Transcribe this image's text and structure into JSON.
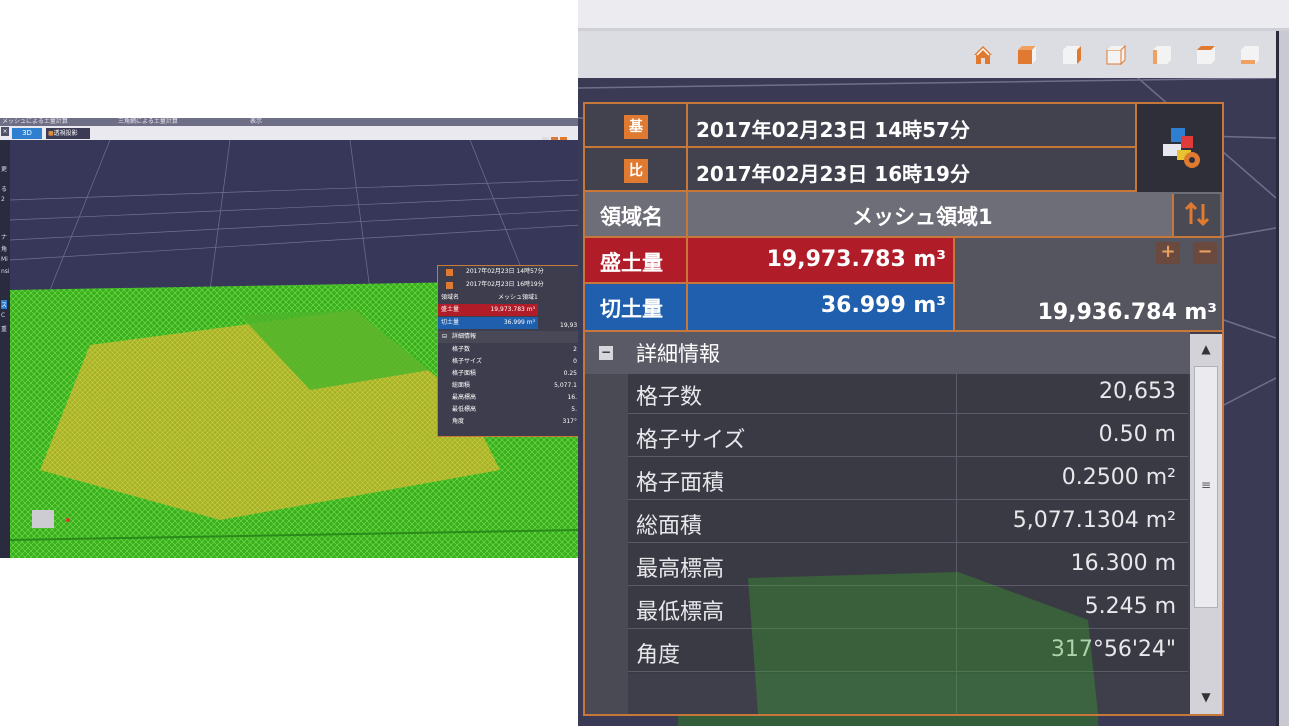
{
  "small_screenshot": {
    "menu": [
      "メッシュによる土量計算",
      "三角網による土量計算",
      "表示"
    ],
    "tab_active": "3D",
    "tab_perspective": "透視投影",
    "left_labels": [
      "更",
      "る",
      "2",
      "ナ",
      "角",
      "Mi",
      "nsi",
      "ス",
      "C",
      "重"
    ],
    "close": "×",
    "panel": {
      "base_date": "2017年02月23日 14時57分",
      "compare_date": "2017年02月23日 16時19分",
      "region_label": "領域名",
      "region_value": "メッシュ領域1",
      "fill_label": "盛土量",
      "fill_value": "19,973.783 m³",
      "cut_label": "切土量",
      "cut_value": "36.999 m³",
      "net_partial": "19,93",
      "details_title": "詳細情報",
      "rows": [
        {
          "k": "格子数",
          "v": "2"
        },
        {
          "k": "格子サイズ",
          "v": "0"
        },
        {
          "k": "格子面積",
          "v": "0.25"
        },
        {
          "k": "総面積",
          "v": "5,077.1"
        },
        {
          "k": "最高標高",
          "v": "16."
        },
        {
          "k": "最低標高",
          "v": "5."
        },
        {
          "k": "角度",
          "v": "317°"
        }
      ]
    }
  },
  "toolbar_icons": [
    "home-icon",
    "view-top-icon",
    "view-front-icon",
    "view-right-icon",
    "view-back-icon",
    "view-left-icon",
    "view-bottom-icon"
  ],
  "panel": {
    "base_badge": "基",
    "base_date": "2017年02月23日 14時57分",
    "compare_badge": "比",
    "compare_date": "2017年02月23日 16時19分",
    "region_label": "領域名",
    "region_value": "メッシュ領域1",
    "fill_label": "盛土量",
    "fill_value": "19,973.783 m³",
    "cut_label": "切土量",
    "cut_value": "36.999 m³",
    "net_value": "19,936.784 m³",
    "plus": "+",
    "minus": "−",
    "details_title": "詳細情報",
    "collapse": "−",
    "details": [
      {
        "k": "格子数",
        "v": "20,653"
      },
      {
        "k": "格子サイズ",
        "v": "0.50 m"
      },
      {
        "k": "格子面積",
        "v": "0.2500 m²"
      },
      {
        "k": "総面積",
        "v": "5,077.1304 m²"
      },
      {
        "k": "最高標高",
        "v": "16.300 m"
      },
      {
        "k": "最低標高",
        "v": "5.245 m"
      },
      {
        "k": "角度",
        "v": "317°56'24\""
      }
    ]
  },
  "colors": {
    "accent_orange": "#c8773a",
    "fill_red": "#b01c28",
    "cut_blue": "#1f5fae"
  }
}
